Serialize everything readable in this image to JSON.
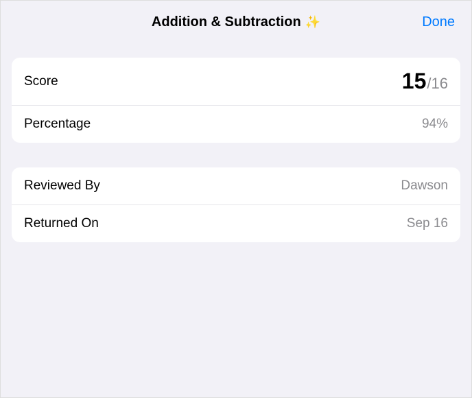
{
  "header": {
    "title": "Addition & Subtraction",
    "sparkle": "✨",
    "done_label": "Done"
  },
  "score_card": {
    "score_label": "Score",
    "score_numerator": "15",
    "score_slash": "/",
    "score_denominator": "16",
    "percentage_label": "Percentage",
    "percentage_value": "94%"
  },
  "review_card": {
    "reviewed_by_label": "Reviewed By",
    "reviewed_by_value": "Dawson",
    "returned_on_label": "Returned On",
    "returned_on_value": "Sep 16"
  }
}
